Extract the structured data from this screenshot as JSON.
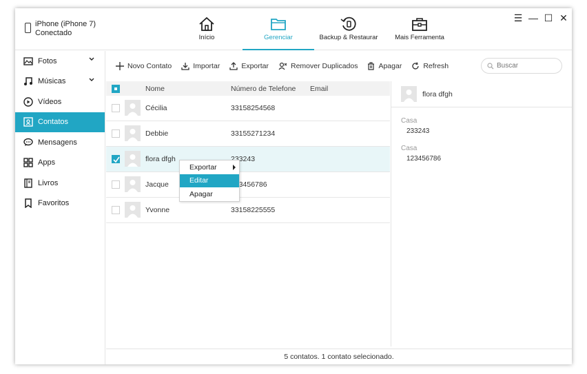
{
  "device": {
    "name": "iPhone (iPhone 7)",
    "status": "Conectado"
  },
  "nav": [
    {
      "label": "Início",
      "icon": "home-icon"
    },
    {
      "label": "Gerenciar",
      "icon": "folder-icon",
      "active": true
    },
    {
      "label": "Backup & Restaurar",
      "icon": "backup-restore-icon"
    },
    {
      "label": "Mais Ferramenta",
      "icon": "toolbox-icon"
    }
  ],
  "window_controls": {
    "menu": "☰",
    "minimize": "—",
    "maximize": "☐",
    "close": "✕"
  },
  "sidebar": {
    "items": [
      {
        "label": "Fotos",
        "icon": "photo-icon",
        "expandable": true
      },
      {
        "label": "Músicas",
        "icon": "music-icon",
        "expandable": true
      },
      {
        "label": "Vídeos",
        "icon": "video-icon"
      },
      {
        "label": "Contatos",
        "icon": "contacts-icon",
        "active": true
      },
      {
        "label": "Mensagens",
        "icon": "message-icon"
      },
      {
        "label": "Apps",
        "icon": "apps-icon"
      },
      {
        "label": "Livros",
        "icon": "book-icon"
      },
      {
        "label": "Favoritos",
        "icon": "bookmark-icon"
      }
    ]
  },
  "toolbar": {
    "new_contact": "Novo Contato",
    "import": "Importar",
    "export": "Exportar",
    "remove_duplicates": "Remover Duplicados",
    "delete": "Apagar",
    "refresh": "Refresh",
    "search_placeholder": "Buscar"
  },
  "table": {
    "headers": {
      "name": "Nome",
      "phone": "Número de Telefone",
      "email": "Email"
    },
    "rows": [
      {
        "name": "Cécilia",
        "phone": "33158254568",
        "selected": false
      },
      {
        "name": "Debbie",
        "phone": "33155271234",
        "selected": false
      },
      {
        "name": "flora dfgh",
        "phone": "233243",
        "selected": true
      },
      {
        "name": "Jacque",
        "phone": "123456786",
        "selected": false
      },
      {
        "name": "Yvonne",
        "phone": "33158225555",
        "selected": false
      }
    ]
  },
  "context_menu": {
    "items": [
      {
        "label": "Exportar",
        "submenu": true
      },
      {
        "label": "Editar",
        "highlighted": true
      },
      {
        "label": "Apagar"
      }
    ]
  },
  "detail": {
    "name": "flora dfgh",
    "fields": [
      {
        "label": "Casa",
        "value": "233243"
      },
      {
        "label": "Casa",
        "value": "123456786"
      }
    ]
  },
  "status": "5 contatos. 1 contato selecionado.",
  "colors": {
    "accent": "#21a6c4"
  }
}
